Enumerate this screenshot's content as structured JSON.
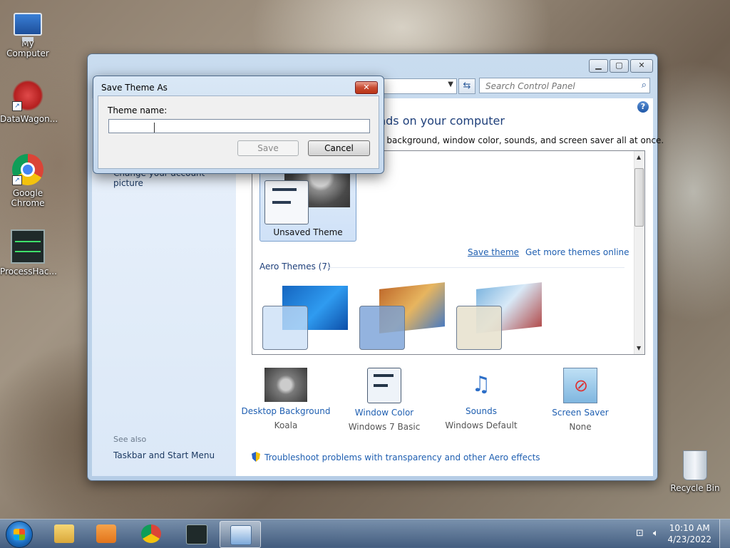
{
  "desktop": {
    "icons": [
      {
        "label": "My Computer"
      },
      {
        "label": "DataWagon..."
      },
      {
        "label": "Google Chrome"
      },
      {
        "label": "ProcessHac..."
      },
      {
        "label": "Recycle Bin"
      }
    ]
  },
  "main_window": {
    "search_placeholder": "Search Control Panel",
    "help_label": "?",
    "heading": "nds on your computer",
    "description": "p background, window color, sounds, and screen saver all at once.",
    "left_pane": {
      "link_account_picture": "Change your account picture",
      "see_also": "See also",
      "taskbar_link": "Taskbar and Start Menu"
    },
    "themes": {
      "unsaved_label": "Unsaved Theme",
      "save_theme_link": "Save theme",
      "more_online_link": "Get more themes online",
      "aero_title": "Aero Themes (7)"
    },
    "bottom": [
      {
        "title": "Desktop Background",
        "sub": "Koala"
      },
      {
        "title": "Window Color",
        "sub": "Windows 7 Basic"
      },
      {
        "title": "Sounds",
        "sub": "Windows Default"
      },
      {
        "title": "Screen Saver",
        "sub": "None"
      }
    ],
    "troubleshoot": "Troubleshoot problems with transparency and other Aero effects"
  },
  "dialog": {
    "title": "Save Theme As",
    "label": "Theme name:",
    "input_value": "",
    "save_button": "Save",
    "cancel_button": "Cancel"
  },
  "taskbar": {
    "time": "10:10 AM",
    "date": "4/23/2022"
  },
  "colors": {
    "link": "#1f5fb1",
    "heading": "#1e3f7a",
    "close_red": "#c84b31"
  }
}
